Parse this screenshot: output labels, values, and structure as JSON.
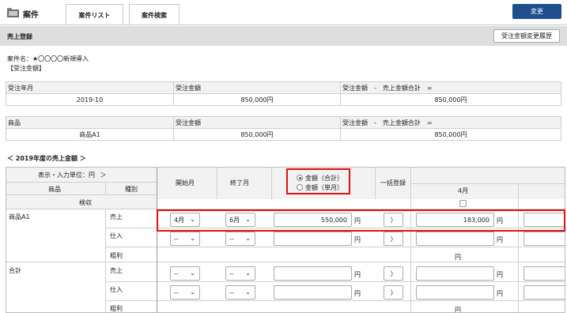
{
  "header": {
    "app_title": "案件",
    "icon": "folder-icon",
    "tabs": [
      "案件リスト",
      "案件検索"
    ],
    "change_button": "変更",
    "accent_color": "#1d4f8c"
  },
  "subheader": {
    "title": "売上登録",
    "history_button": "受注金額変更履歴"
  },
  "case": {
    "name_line": "案件名：★〇〇〇〇新規導入",
    "section_label": "【受注金額】"
  },
  "summary_table": {
    "headers": [
      "受注年月",
      "受注金額",
      "受注金額　-　売上金額合計　="
    ],
    "row": [
      "2019-10",
      "850,000円",
      "850,000円"
    ]
  },
  "product_table": {
    "headers": [
      "商品",
      "受注金額",
      "受注金額　-　売上金額合計　="
    ],
    "row": [
      "商品A1",
      "850,000円",
      "850,000円"
    ]
  },
  "year_nav": {
    "prev": "＜",
    "label": "2019年度の売上金額",
    "next": "＞"
  },
  "grid": {
    "display_unit": "表示・入力単位：円",
    "display_unit_arrow": "＞",
    "col_product": "商品",
    "col_type": "種別",
    "inspection": "検収",
    "col_start": "開始月",
    "col_end": "終了月",
    "radio_total": "金額（合計）",
    "radio_monthly": "金額（単月）",
    "col_bulk": "一括登録",
    "col_month": "4月",
    "yen": "円",
    "bulk_button": "〉",
    "groups": [
      {
        "name": "商品A1",
        "rows": [
          {
            "type": "売上",
            "start": "4月",
            "end": "6月",
            "amount": "550,000",
            "month_value": "183,000"
          },
          {
            "type": "仕入",
            "start": "--",
            "end": "--",
            "amount": "",
            "month_value": ""
          },
          {
            "type": "粗利",
            "month_value": "円"
          }
        ]
      },
      {
        "name": "合計",
        "rows": [
          {
            "type": "売上",
            "start": "--",
            "end": "--",
            "amount": "",
            "month_value": ""
          },
          {
            "type": "仕入",
            "start": "--",
            "end": "--",
            "amount": "",
            "month_value": ""
          },
          {
            "type": "粗利",
            "month_value": "円"
          }
        ]
      }
    ]
  }
}
